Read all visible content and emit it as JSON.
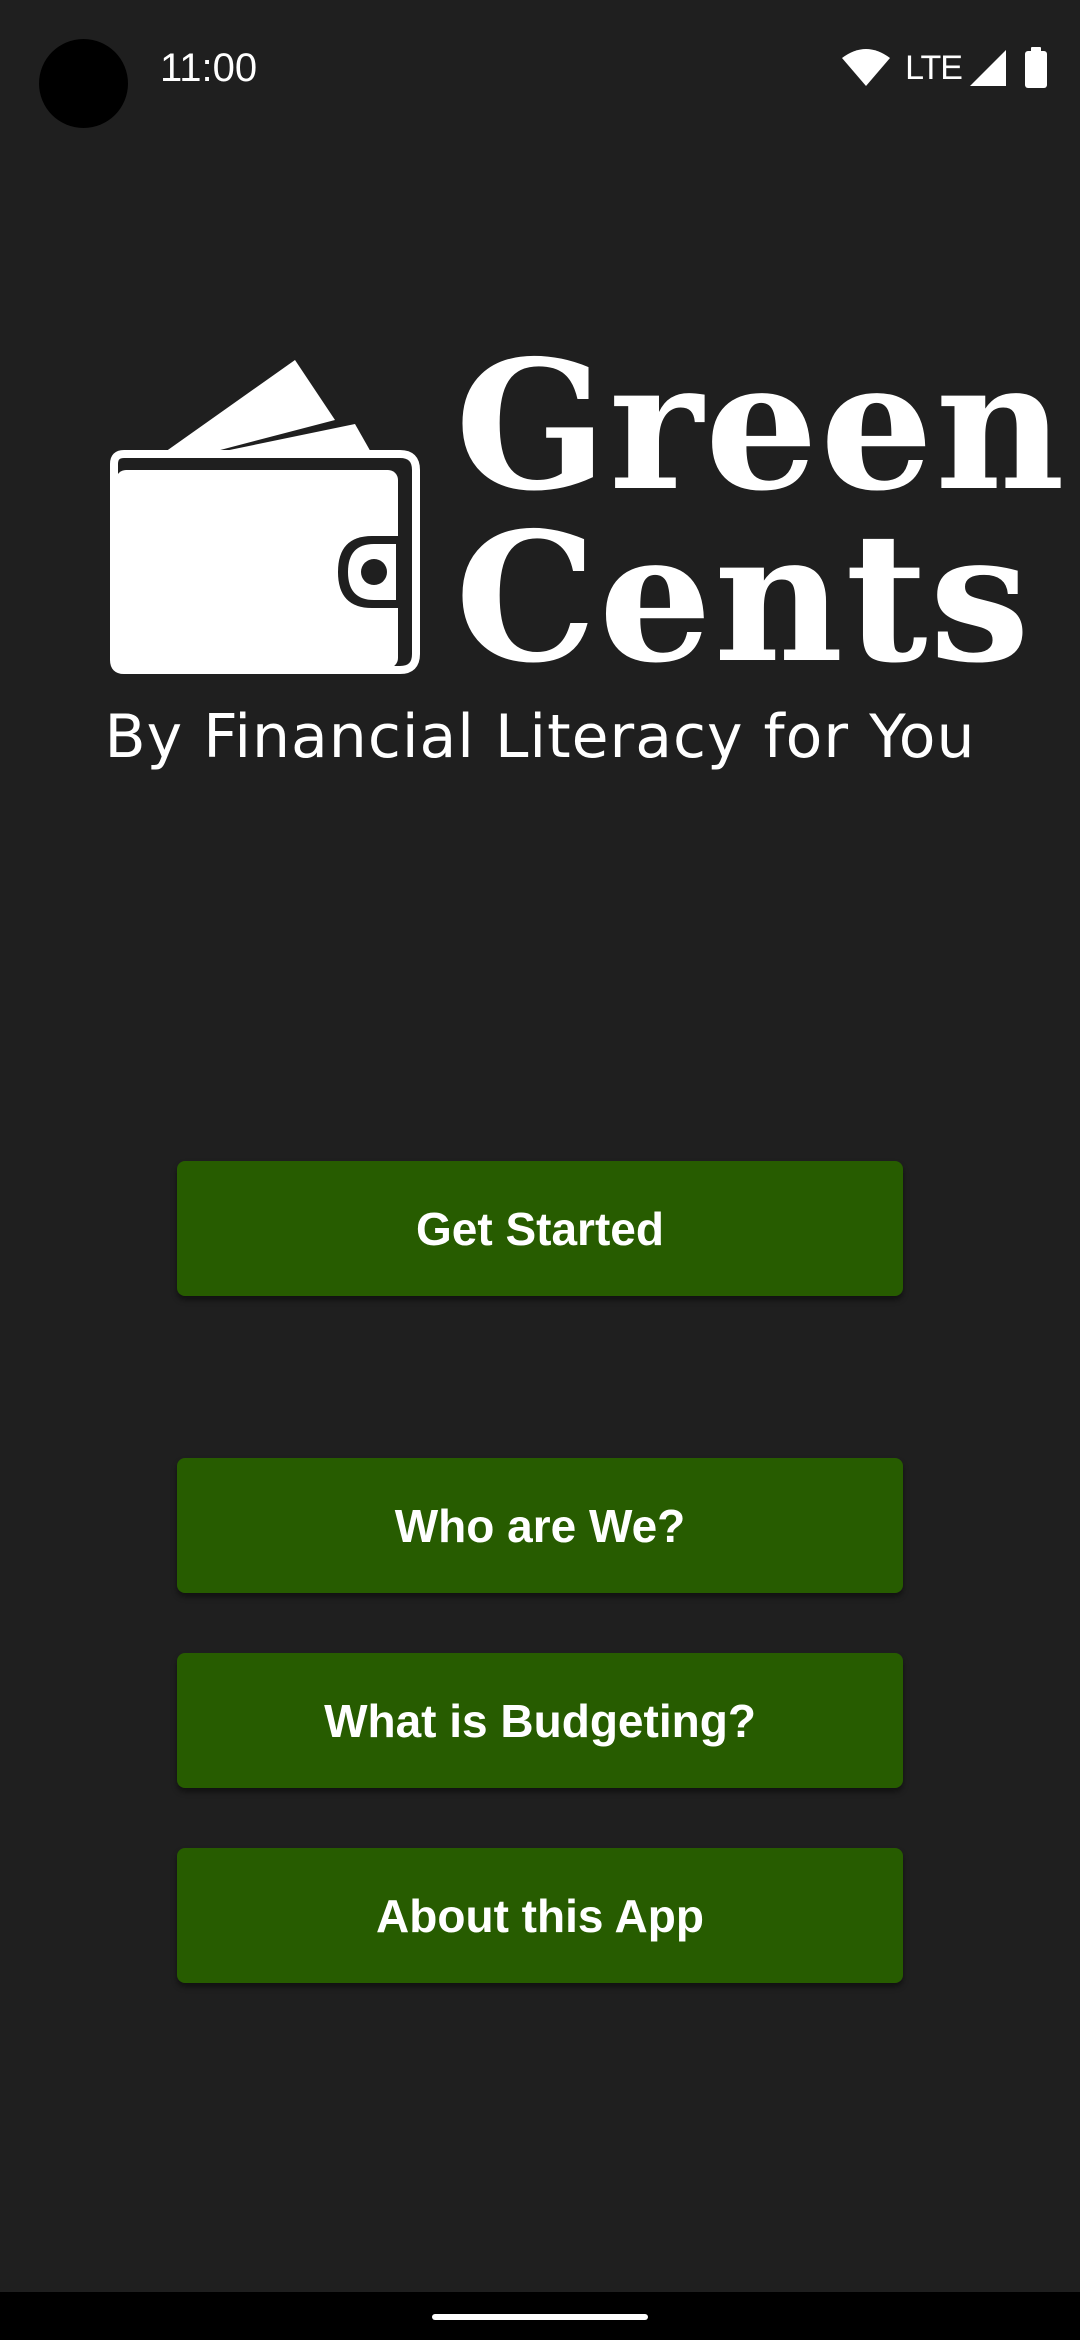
{
  "status_bar": {
    "time": "11:00",
    "network_label": "LTE",
    "icons": [
      "wifi-icon",
      "cell-signal-icon",
      "battery-icon"
    ]
  },
  "logo": {
    "title_line1": "Green",
    "title_line2": "Cents",
    "tagline": "By Financial Literacy for You",
    "icon": "wallet-icon"
  },
  "menu": {
    "get_started": "Get Started",
    "who_are_we": "Who are We?",
    "what_is_budgeting": "What is Budgeting?",
    "about_app": "About this App"
  },
  "colors": {
    "background": "#1f1f1f",
    "button": "#275c00",
    "text": "#ffffff"
  }
}
